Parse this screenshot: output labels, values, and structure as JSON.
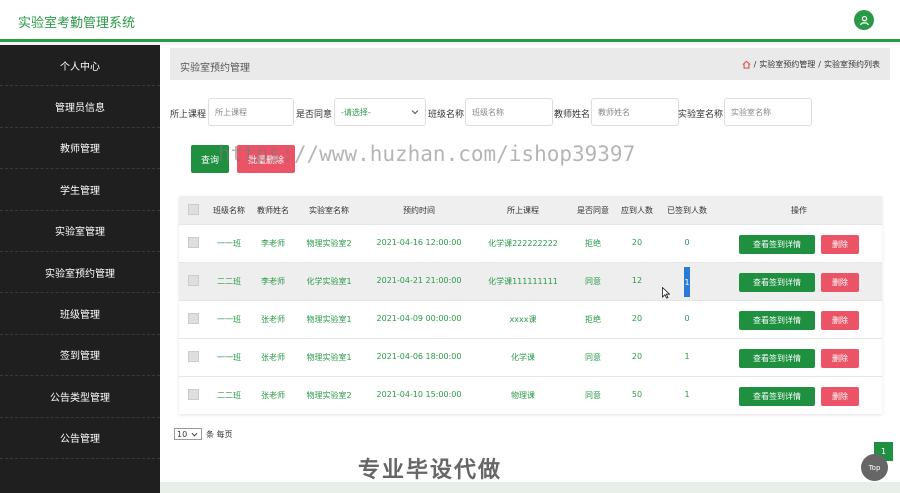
{
  "header": {
    "title": "实验室考勤管理系统"
  },
  "sidebar": {
    "items": [
      "个人中心",
      "管理员信息",
      "教师管理",
      "学生管理",
      "实验室管理",
      "实验室预约管理",
      "班级管理",
      "签到管理",
      "公告类型管理",
      "公告管理"
    ]
  },
  "page": {
    "title": "实验室预约管理",
    "breadcrumb": [
      "实验室预约管理",
      "实验室预约列表"
    ],
    "separator": "/"
  },
  "filters": {
    "course_label": "所上课程",
    "course_placeholder": "所上课程",
    "agree_label": "是否同意",
    "agree_value": "-请选择-",
    "class_label": "班级名称",
    "class_placeholder": "班级名称",
    "teacher_label": "教师姓名",
    "teacher_placeholder": "教师姓名",
    "lab_label": "实验室名称",
    "lab_placeholder": "实验室名称"
  },
  "buttons": {
    "query": "查询",
    "delete_batch": "批量删除",
    "detail": "查看签到详情",
    "delete": "删除"
  },
  "watermark": "https://www.huzhan.com/ishop39397",
  "table": {
    "headers": [
      "班级名称",
      "教师姓名",
      "实验室名称",
      "预约时间",
      "所上课程",
      "是否同意",
      "应到人数",
      "已签到人数",
      "操作"
    ],
    "rows": [
      [
        "一一班",
        "李老师",
        "物理实验室2",
        "2021-04-16 12:00:00",
        "化学课222222222",
        "拒绝",
        "20",
        "0"
      ],
      [
        "二二班",
        "李老师",
        "化学实验室1",
        "2021-04-21 21:00:00",
        "化学课111111111",
        "同意",
        "12",
        "1"
      ],
      [
        "一一班",
        "张老师",
        "物理实验室1",
        "2021-04-09 00:00:00",
        "xxxx课",
        "拒绝",
        "20",
        "0"
      ],
      [
        "一一班",
        "张老师",
        "物理实验室1",
        "2021-04-06 18:00:00",
        "化学课",
        "同意",
        "20",
        "1"
      ],
      [
        "二二班",
        "张老师",
        "物理实验室2",
        "2021-04-10 15:00:00",
        "物理课",
        "同意",
        "50",
        "1"
      ]
    ]
  },
  "pager": {
    "size": "10",
    "suffix": "条 每页"
  },
  "page_number": "1",
  "top_label": "Top",
  "promo": "专业毕设代做",
  "colors": {
    "primary": "#1e9040",
    "danger": "#ea5466",
    "sidebar": "#1f1f1f"
  }
}
